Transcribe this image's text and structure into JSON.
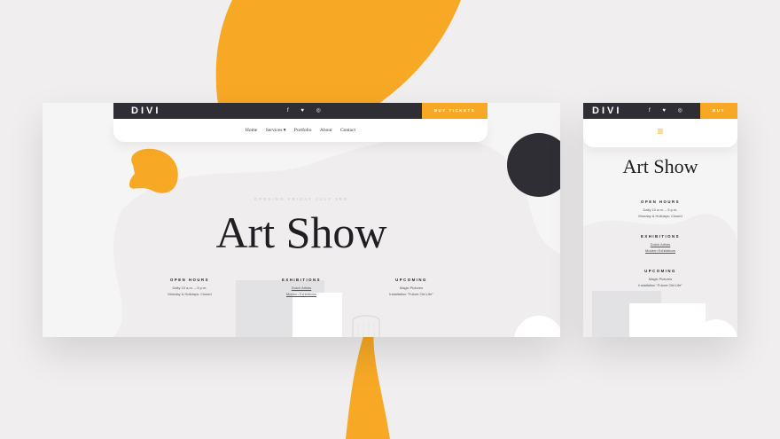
{
  "colors": {
    "accent": "#f7a926",
    "dark": "#2e2e34",
    "background": "#f0eeee"
  },
  "desktop": {
    "logo": "DIVI",
    "social_icons": [
      "facebook-icon",
      "twitter-icon",
      "instagram-icon"
    ],
    "social_glyphs": "f  ♥  ◎",
    "tickets_label": "BUY TICKETS",
    "nav": [
      "Home",
      "Services",
      "Portfolio",
      "About",
      "Contact"
    ],
    "services_caret": "▾",
    "kicker": "OPENING FRIDAY JULY 3RD",
    "title": "Art Show",
    "columns": [
      {
        "heading": "OPEN HOURS",
        "lines": [
          "Daily 10 a.m. – 5 p.m.",
          "Monday & Holidays: Closed"
        ]
      },
      {
        "heading": "EXHIBITIONS",
        "lines": [
          "Dutch Artists",
          "Modern Exhibitions"
        ]
      },
      {
        "heading": "UPCOMING",
        "lines": [
          "Magic Pictures",
          "Installation \"Future Old Life\""
        ]
      }
    ]
  },
  "mobile": {
    "logo": "DIVI",
    "social_glyphs": "f  ♥  ◎",
    "tickets_label": "BUY TICKETS",
    "menu_icon": "hamburger-icon",
    "menu_glyph": "≡",
    "title": "Art Show",
    "columns": [
      {
        "heading": "OPEN HOURS",
        "lines": [
          "Daily 10 a.m. – 5 p.m.",
          "Monday & Holidays: Closed"
        ]
      },
      {
        "heading": "EXHIBITIONS",
        "lines": [
          "Dutch Artists",
          "Modern Exhibitions"
        ]
      },
      {
        "heading": "UPCOMING",
        "lines": [
          "Magic Pictures",
          "Installation \"Future Old Life\""
        ]
      }
    ]
  }
}
